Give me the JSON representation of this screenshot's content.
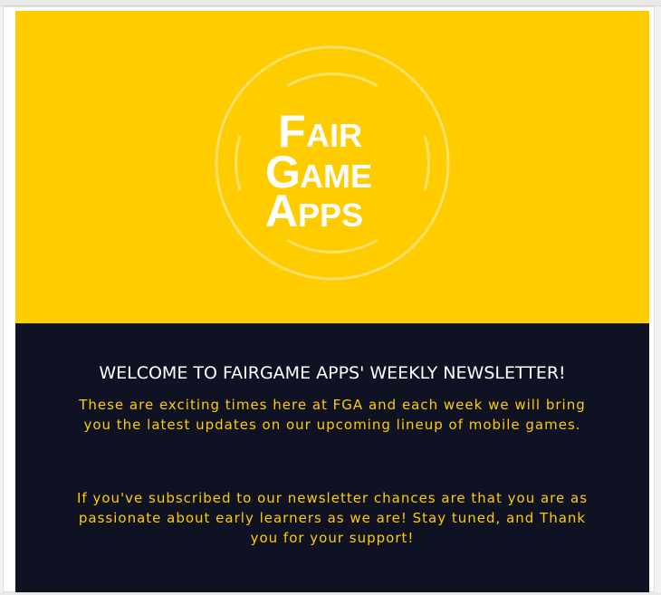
{
  "newsletter": {
    "logo": {
      "line1": "FAIR",
      "line2": "GAME",
      "line3": "APPS"
    },
    "headline": "WELCOME TO FAIRGAME APPS' WEEKLY NEWSLETTER!",
    "paragraph1": "These are exciting times here at FGA and each week we will bring you the latest updates on our upcoming lineup of mobile games.",
    "paragraph2": "If you've subscribed to our newsletter chances are that you are as passionate about early learners as we are! Stay tuned, and Thank you for your support!"
  },
  "colors": {
    "brand_yellow": "#ffcc00",
    "dark_navy": "#0f1222",
    "white": "#ffffff"
  }
}
